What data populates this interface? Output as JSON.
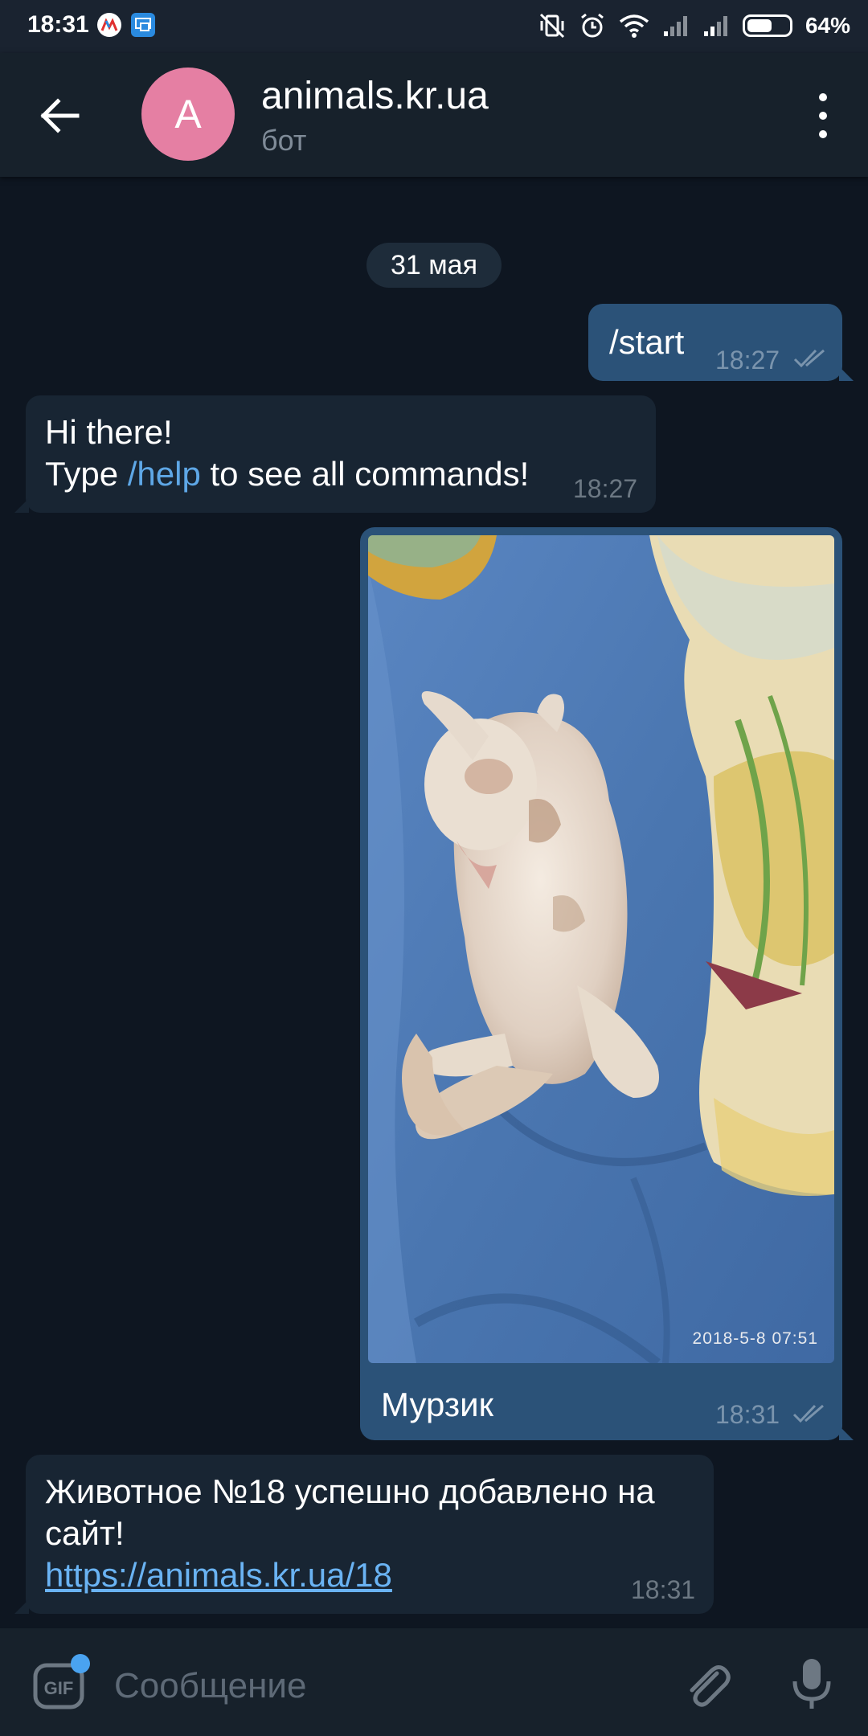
{
  "status_bar": {
    "time": "18:31",
    "battery_text": "64%",
    "battery_level": 0.64,
    "icons": [
      "vibrate-off-icon",
      "alarm-icon",
      "wifi-icon",
      "signal-icon",
      "signal-icon",
      "battery-icon"
    ]
  },
  "header": {
    "avatar_letter": "A",
    "avatar_color": "#e57fa3",
    "title": "animals.kr.ua",
    "subtitle": "бот"
  },
  "chat": {
    "date_separator": "31 мая",
    "messages": [
      {
        "direction": "out",
        "text": "/start",
        "time": "18:27",
        "status": "read"
      },
      {
        "direction": "in",
        "line1": "Hi there!",
        "line2_pre": "Type ",
        "line2_cmd": "/help",
        "line2_post": " to see all commands!",
        "time": "18:27"
      },
      {
        "direction": "out",
        "type": "photo",
        "photo_stamp": "2018-5-8 07:51",
        "caption": "Мурзик",
        "time": "18:31",
        "status": "read"
      },
      {
        "direction": "in",
        "line1": "Животное №18 успешно добавлено на",
        "line2": "сайт!",
        "link": "https://animals.kr.ua/18",
        "time": "18:31"
      }
    ]
  },
  "input": {
    "placeholder": "Сообщение",
    "value": ""
  },
  "colors": {
    "background": "#0e1621",
    "header": "#17212b",
    "bubble_out": "#2b5278",
    "bubble_in": "#182533",
    "link": "#6ab3f3"
  }
}
